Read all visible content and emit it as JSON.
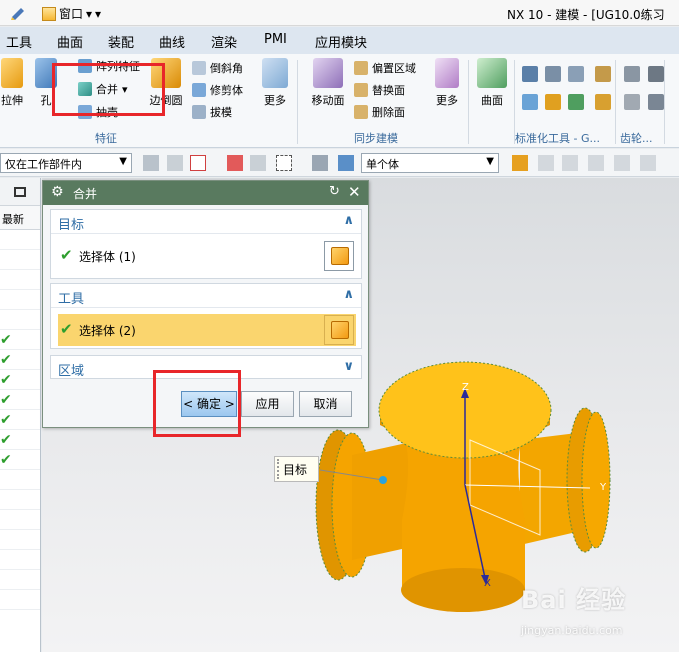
{
  "app": {
    "title": "NX 10 - 建模 - [UG10.0练习",
    "window_menu": "窗口",
    "window_arrow": "▾",
    "pin_arrow": "▾"
  },
  "menubar": {
    "items": [
      "工具",
      "曲面",
      "装配",
      "曲线",
      "渲染",
      "PMI",
      "应用模块"
    ]
  },
  "ribbon": {
    "feature_group": {
      "label": "特征",
      "extrude": "拉伸",
      "hole": "孔",
      "pattern": "阵列特征",
      "unite": "合并",
      "shell": "抽壳",
      "edge_blend": "边倒圆",
      "chamfer": "倒斜角",
      "trim_body": "修剪体",
      "draft": "拔模",
      "more": "更多"
    },
    "sync_group": {
      "label": "同步建模",
      "move_face": "移动面",
      "offset_region": "偏置区域",
      "replace_face": "替换面",
      "delete_face": "删除面",
      "more": "更多"
    },
    "surface_group": {
      "surface": "曲面"
    },
    "standard_group": {
      "label": "标准化工具 - G..."
    },
    "gear_group": {
      "label": "齿轮..."
    }
  },
  "selection_bar": {
    "filter_scope": "仅在工作部件内",
    "body_type": "单个体"
  },
  "navigator": {
    "column": "最新",
    "checked_rows": 7
  },
  "dialog": {
    "title": "合并",
    "reset_icon": "↻",
    "close_icon": "✕",
    "target_section": "目标",
    "target_select": "选择体 (1)",
    "tool_section": "工具",
    "tool_select": "选择体 (2)",
    "region_section": "区域",
    "collapse_icon": "∧",
    "expand_icon": "∨",
    "ok": "< 确定 >",
    "apply": "应用",
    "cancel": "取消"
  },
  "viewport": {
    "target_label": "目标",
    "axis_x": "X",
    "axis_y": "Y",
    "axis_z": "Z",
    "colors": {
      "body": "#f5a400",
      "body_dark": "#c97d00",
      "face": "#ffc21a"
    }
  },
  "watermark": {
    "brand": "Bai 经验",
    "url": "jingyan.baidu.com"
  }
}
